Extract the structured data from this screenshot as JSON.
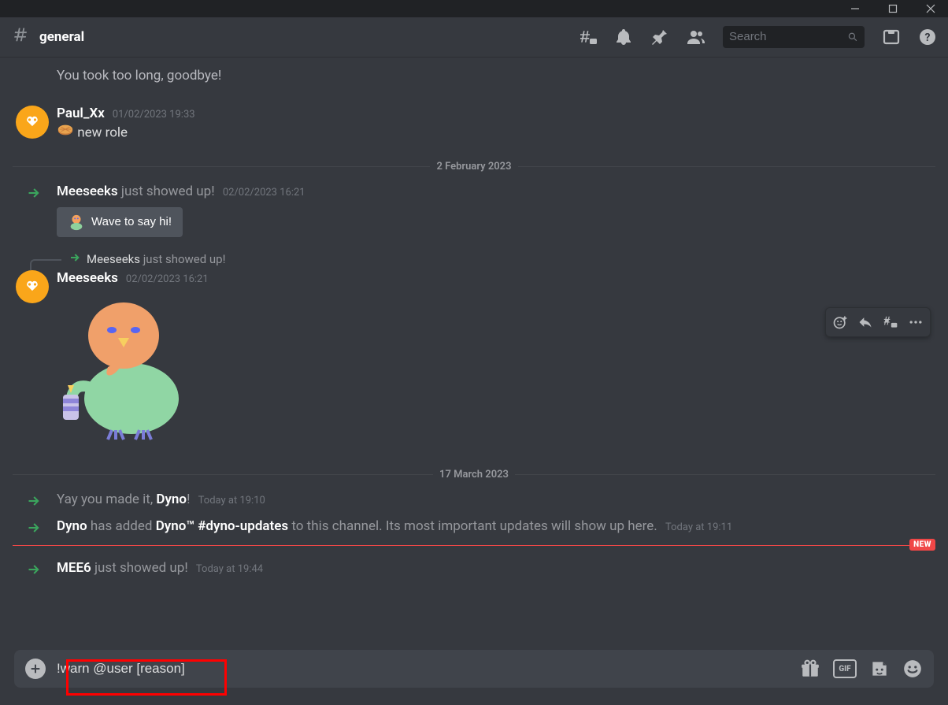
{
  "window_controls": {
    "min": "minimize",
    "max": "maximize",
    "close": "close"
  },
  "channel": {
    "name": "general"
  },
  "header": {
    "search_placeholder": "Search"
  },
  "partial_prev_msg": "You took too long, goodbye!",
  "msg1": {
    "author": "Paul_Xx",
    "timestamp": "01/02/2023 19:33",
    "content": "new role"
  },
  "divider1": "2 February 2023",
  "sys1": {
    "author": "Meeseeks",
    "tail": " just showed up!",
    "timestamp": "02/02/2023 16:21",
    "wave_label": "Wave to say hi!"
  },
  "reply_ref": {
    "author": "Meeseeks",
    "tail": " just showed up!"
  },
  "msg2": {
    "author": "Meeseeks",
    "timestamp": "02/02/2023 16:21"
  },
  "divider2": "17 March 2023",
  "sys2": {
    "pre": "Yay you made it, ",
    "author": "Dyno",
    "post": "!",
    "timestamp": "Today at 19:10"
  },
  "sys3": {
    "author": "Dyno",
    "mid1": " has added ",
    "bold2": "Dyno™ #dyno-updates",
    "mid2": " to this channel. Its most important updates will show up here.",
    "timestamp": "Today at 19:11"
  },
  "new_pill": "NEW",
  "sys4": {
    "author": "MEE6",
    "tail": " just showed up!",
    "timestamp": "Today at 19:44"
  },
  "input": {
    "value": "!warn @user [reason]"
  },
  "gif_label": "GIF"
}
